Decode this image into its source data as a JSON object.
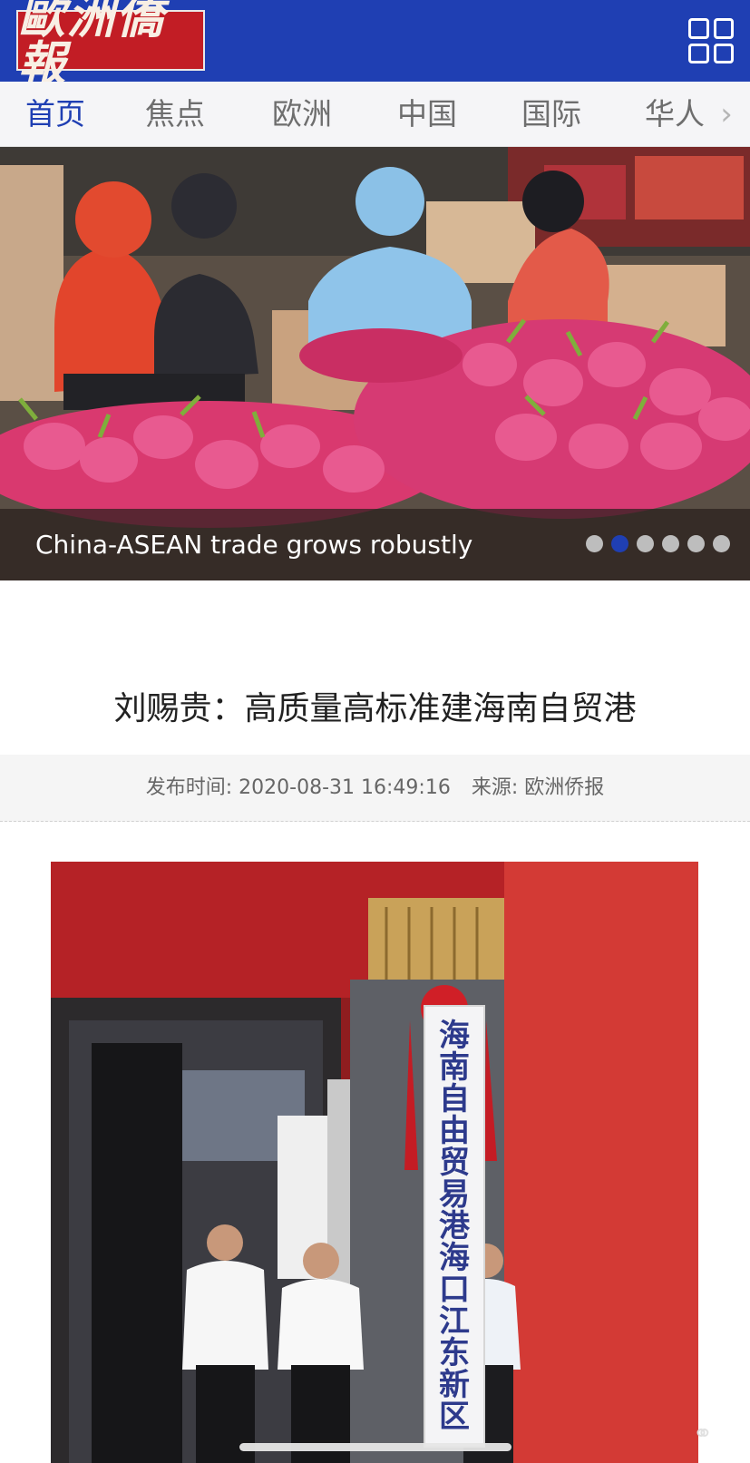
{
  "header": {
    "logo_text": "歐洲僑報",
    "menu_icon": "grid-menu-icon",
    "colors": {
      "bar": "#1f3fb3",
      "logo_bg": "#c21d25"
    }
  },
  "nav": {
    "tabs": [
      {
        "label": "首页",
        "active": true
      },
      {
        "label": "焦点",
        "active": false
      },
      {
        "label": "欧洲",
        "active": false
      },
      {
        "label": "中国",
        "active": false
      },
      {
        "label": "国际",
        "active": false
      },
      {
        "label": "华人",
        "active": false
      }
    ],
    "more_icon": "chevron-right-icon"
  },
  "slideshow": {
    "caption": "China-ASEAN trade grows robustly",
    "slide_count": 6,
    "active_index": 1
  },
  "article": {
    "title": "刘赐贵：高质量高标准建海南自贸港",
    "meta": {
      "time_label": "发布时间: 2020-08-31 16:49:16",
      "source_label": "来源: 欧洲侨报"
    },
    "photo": {
      "plaque_text": [
        "海",
        "南",
        "自",
        "由",
        "贸",
        "易",
        "港",
        "海",
        "口",
        "江",
        "东",
        "新",
        "区"
      ]
    }
  }
}
